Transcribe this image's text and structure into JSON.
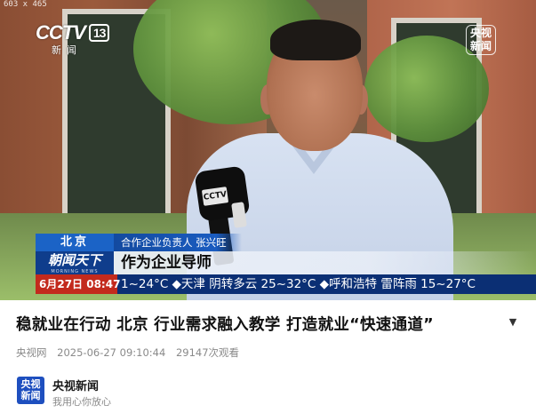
{
  "size_tag": "603 x 465",
  "logo": {
    "brand": "CCTV",
    "channel_number": "13",
    "subtitle": "新闻"
  },
  "corner_badge": {
    "line1": "央视",
    "line2": "新闻"
  },
  "mic_logo": "CCTV",
  "lower_third": {
    "city": "北京",
    "role": "合作企业负责人  张兴旺",
    "program": "朝闻天下",
    "program_sub": "MORNING NEWS",
    "headline": "作为企业导师",
    "ticker_date": "6月27日 08:47",
    "ticker_text": "1~24°C  ◆天津  阴转多云  25~32°C  ◆呼和浩特  雷阵雨  15~27°C"
  },
  "video_info": {
    "title": "稳就业在行动 北京 行业需求融入教学 打造就业“快速通道”",
    "source": "央视网",
    "datetime": "2025-06-27 09:10:44",
    "views": "29147次观看"
  },
  "channel": {
    "logo_text_1": "央视",
    "logo_text_2": "新闻",
    "name": "央视新闻",
    "slogan": "我用心你放心"
  },
  "icons": {
    "expand": "chevron-down-icon"
  }
}
